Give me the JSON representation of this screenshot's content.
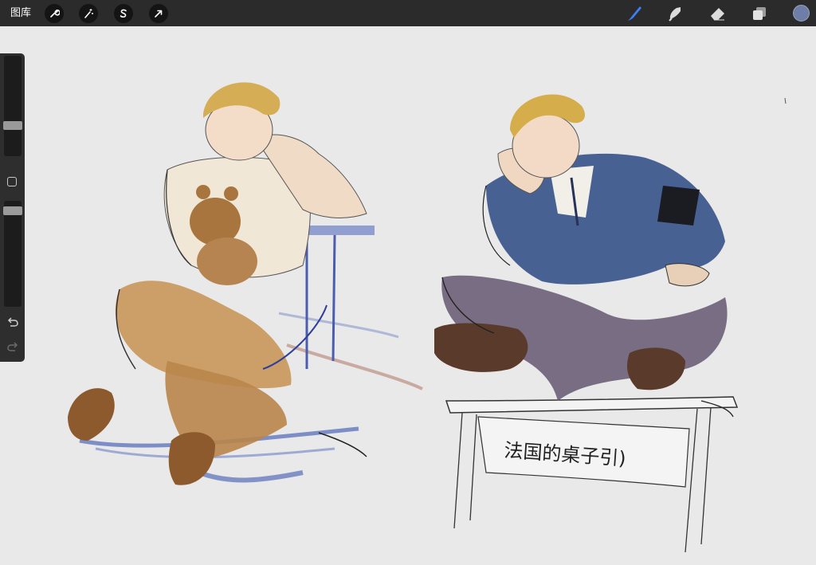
{
  "topbar": {
    "gallery_label": "图库",
    "left_tools": [
      {
        "name": "actions",
        "icon": "wrench-icon"
      },
      {
        "name": "adjustments",
        "icon": "magic-wand-icon"
      },
      {
        "name": "selection",
        "icon": "selection-s-icon"
      },
      {
        "name": "transform",
        "icon": "arrow-cursor-icon"
      }
    ],
    "right_tools": [
      {
        "name": "brush",
        "icon": "brush-icon",
        "active": true
      },
      {
        "name": "smudge",
        "icon": "smudge-icon"
      },
      {
        "name": "eraser",
        "icon": "eraser-icon"
      },
      {
        "name": "layers",
        "icon": "layers-icon"
      }
    ],
    "current_color": "#6f7ea6",
    "active_tool_color": "#3d7ef5"
  },
  "sidebar": {
    "brush_size_level": 0.35,
    "opacity_level": 0.92,
    "modify_icon": "square-outline-icon",
    "undo_icon": "undo-icon",
    "redo_icon": "redo-icon"
  },
  "canvas": {
    "background": "#e9e9e9",
    "handwritten_note": "法国的桌子引)"
  }
}
